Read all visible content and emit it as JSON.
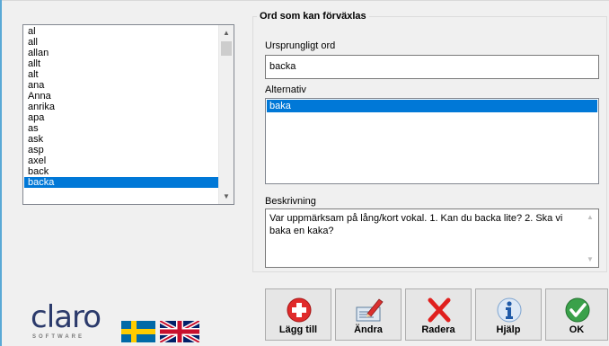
{
  "word_list": {
    "items": [
      "al",
      "all",
      "allan",
      "allt",
      "alt",
      "ana",
      "Anna",
      "anrika",
      "apa",
      "as",
      "ask",
      "asp",
      "axel",
      "back",
      "backa"
    ],
    "selected": "backa"
  },
  "group": {
    "title": "Ord som kan förväxlas",
    "original_word_label": "Ursprungligt ord",
    "original_word_value": "backa",
    "alternatives_label": "Alternativ",
    "alternatives": [
      "baka"
    ],
    "description_label": "Beskrivning",
    "description_text": "Var uppmärksam på lång/kort vokal. 1. Kan du backa lite? 2. Ska vi baka en kaka?"
  },
  "branding": {
    "logo_word": "claro",
    "logo_sub": "SOFTWARE"
  },
  "toolbar": {
    "add_label": "Lägg till",
    "edit_label": "Ändra",
    "delete_label": "Radera",
    "help_label": "Hjälp",
    "ok_label": "OK"
  },
  "icons": {
    "add": "plus-icon",
    "edit": "pencil-card-icon",
    "delete": "x-icon",
    "help": "info-icon",
    "ok": "checkmark-icon",
    "flag_swedish": "swedish-flag-icon",
    "flag_english": "uk-flag-icon"
  },
  "colors": {
    "selection": "#0078d7",
    "add_red": "#e02a2a",
    "delete_red": "#e0201e",
    "help_blue": "#1f5aa8",
    "ok_green": "#3aa14a",
    "logo_navy": "#2b3a6b"
  }
}
